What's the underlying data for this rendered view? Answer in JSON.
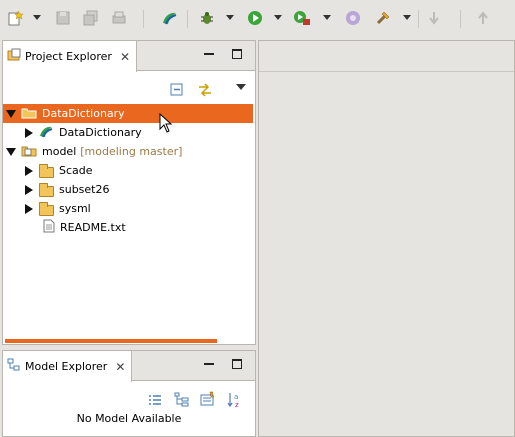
{
  "toolbar": {
    "icons": [
      "new-wizard-icon",
      "save-icon",
      "save-all-icon",
      "print-icon",
      "scade-perspective-icon",
      "debug-icon",
      "run-icon",
      "run-config-icon",
      "external-tools-icon",
      "build-icon",
      "prev-annotation-icon",
      "next-annotation-icon"
    ]
  },
  "project_explorer": {
    "tab_title": "Project Explorer",
    "tree": [
      {
        "label": "DataDictionary",
        "selected": true,
        "expanded": true
      },
      {
        "label": "DataDictionary",
        "indent": 1
      },
      {
        "label": "model",
        "suffix": "[modeling master]",
        "expanded": true
      },
      {
        "label": "Scade",
        "indent": 1
      },
      {
        "label": "subset26",
        "indent": 1
      },
      {
        "label": "sysml",
        "indent": 1
      },
      {
        "label": "README.txt",
        "indent": 1
      }
    ]
  },
  "model_explorer": {
    "tab_title": "Model Explorer",
    "empty_message": "No Model Available"
  },
  "colors": {
    "selection": "#e9671e",
    "scrollbar": "#e9671e"
  }
}
